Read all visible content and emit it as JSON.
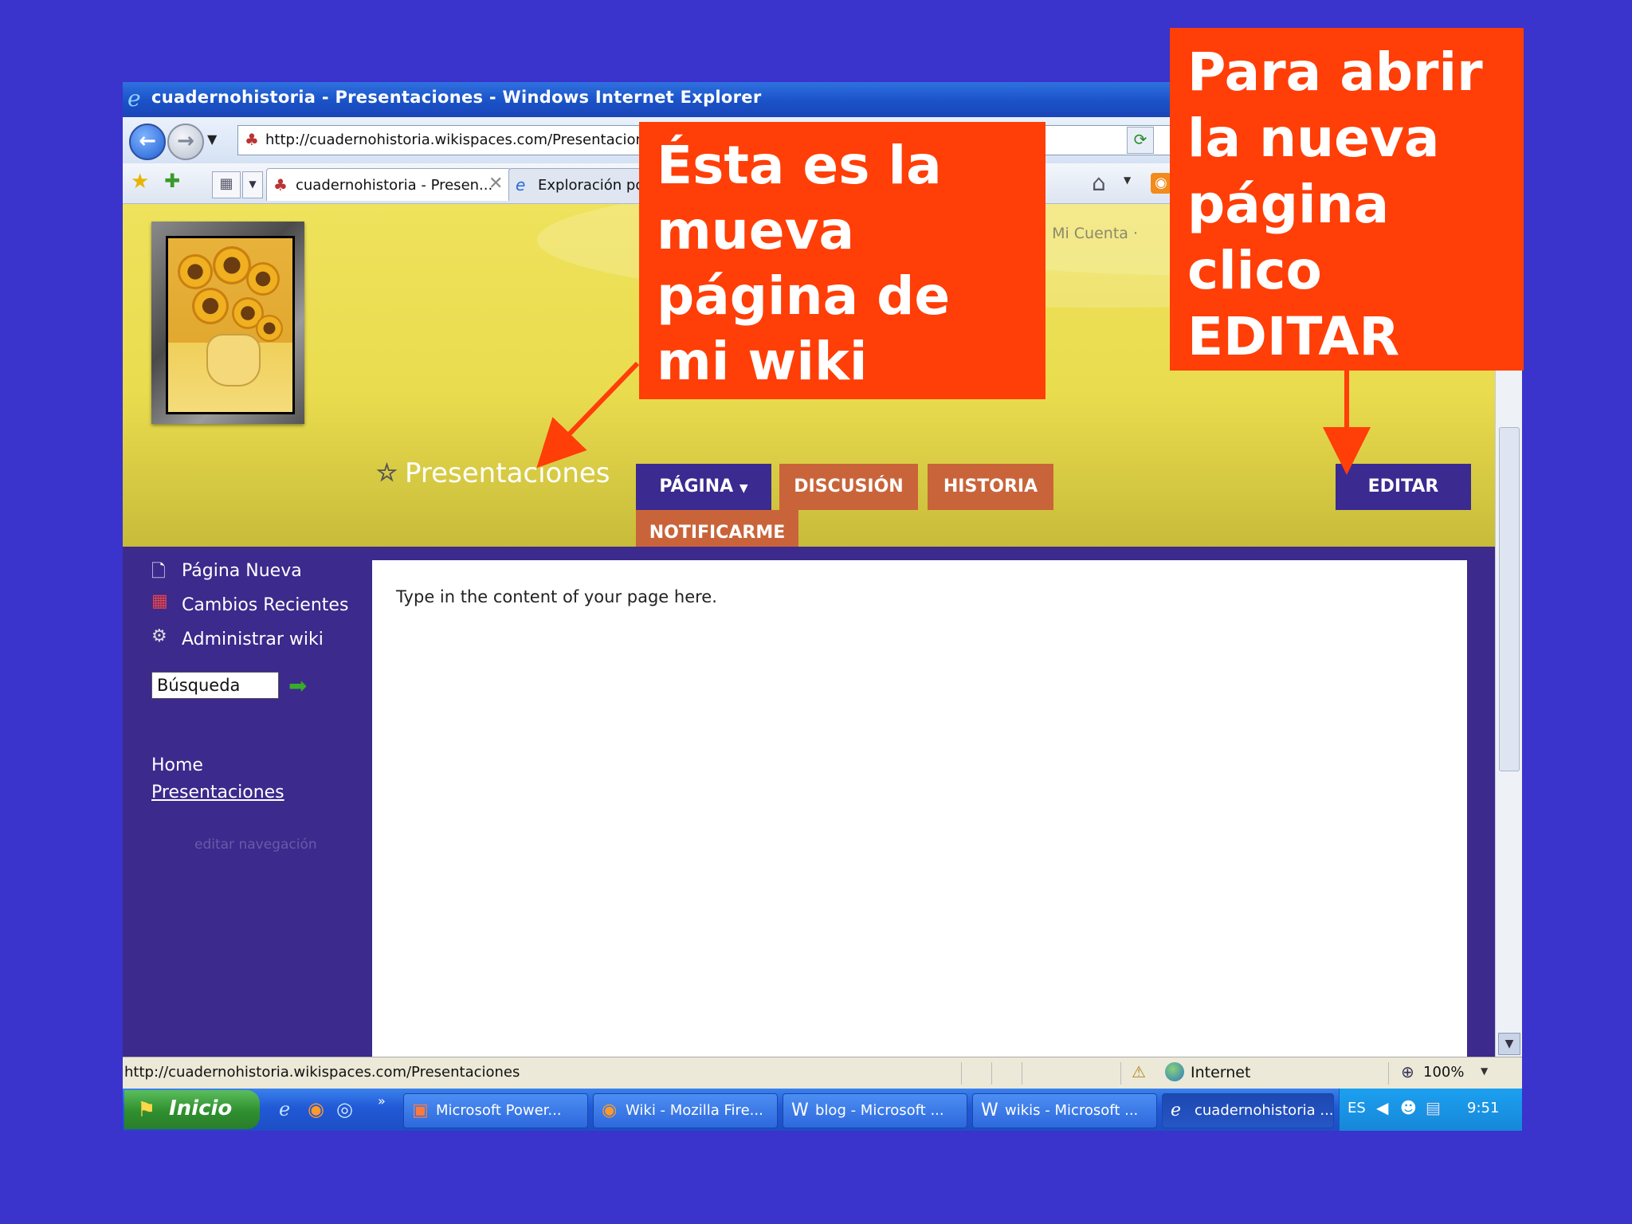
{
  "window": {
    "title": "cuadernohistoria - Presentaciones - Windows Internet Explorer",
    "address": "http://cuadernohistoria.wikispaces.com/Presentaciones"
  },
  "tabs": [
    {
      "label": "cuadernohistoria - Presen...",
      "active": true
    },
    {
      "label": "Exploración por",
      "active": false
    }
  ],
  "wiki": {
    "account_link": "· Mi Cuenta ·",
    "page_title": "Presentaciones",
    "buttons": {
      "pagina": "PÁGINA",
      "discusion": "DISCUSIÓN",
      "historia": "HISTORIA",
      "notificarme": "NOTIFICARME",
      "editar": "EDITAR"
    },
    "sidebar": {
      "items": [
        {
          "label": "Página Nueva",
          "icon": "new-page-icon"
        },
        {
          "label": "Cambios Recientes",
          "icon": "calendar-icon"
        },
        {
          "label": "Administrar wiki",
          "icon": "gear-icon"
        }
      ],
      "search_value": "Búsqueda",
      "nav_links": [
        "Home",
        "Presentaciones"
      ],
      "edit_nav": "editar navegación"
    },
    "content_text": "Type in the content of your page here."
  },
  "status_bar": {
    "url": "http://cuadernohistoria.wikispaces.com/Presentaciones",
    "zone": "Internet",
    "zoom": "100%"
  },
  "taskbar": {
    "start_label": "Inicio",
    "tasks": [
      {
        "label": "Microsoft Power..."
      },
      {
        "label": "Wiki - Mozilla Fire..."
      },
      {
        "label": "blog - Microsoft ..."
      },
      {
        "label": "wikis - Microsoft ..."
      },
      {
        "label": "cuadernohistoria ..."
      }
    ],
    "lang": "ES",
    "clock": "9:51"
  },
  "annotations": {
    "left": "Ésta es la\nmueva\npágina de\nmi wiki",
    "right": "Para abrir\nla nueva\npágina\nclico\nEDITAR"
  },
  "colors": {
    "slide_background": "#3a33cc",
    "callout": "#ff3e08",
    "wiki_purple": "#3c2a8c",
    "wiki_orange_button": "#c9643a",
    "wiki_header_yellow": "#efe25c"
  }
}
